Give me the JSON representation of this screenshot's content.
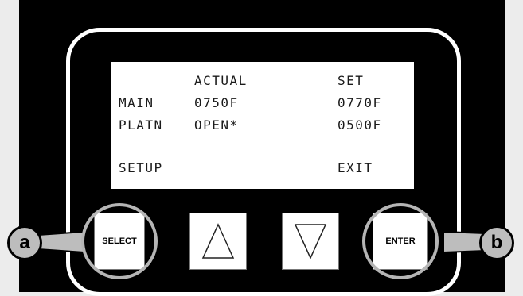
{
  "lcd": {
    "header_actual": "ACTUAL",
    "header_set": "SET",
    "rows": [
      {
        "label": "MAIN",
        "actual": "0750F",
        "set": "0770F"
      },
      {
        "label": "PLATN",
        "actual": "OPEN*",
        "set": "0500F"
      }
    ],
    "setup_label": "SETUP",
    "exit_label": "EXIT"
  },
  "buttons": {
    "select_label": "SELECT",
    "enter_label": "ENTER",
    "up_icon": "triangle-up-icon",
    "down_icon": "triangle-down-icon"
  },
  "callouts": {
    "a": "a",
    "b": "b"
  },
  "colors": {
    "panel": "#000000",
    "background": "#ececec",
    "callout_fill": "#bdbdbd",
    "ring": "#b5b5b5"
  }
}
